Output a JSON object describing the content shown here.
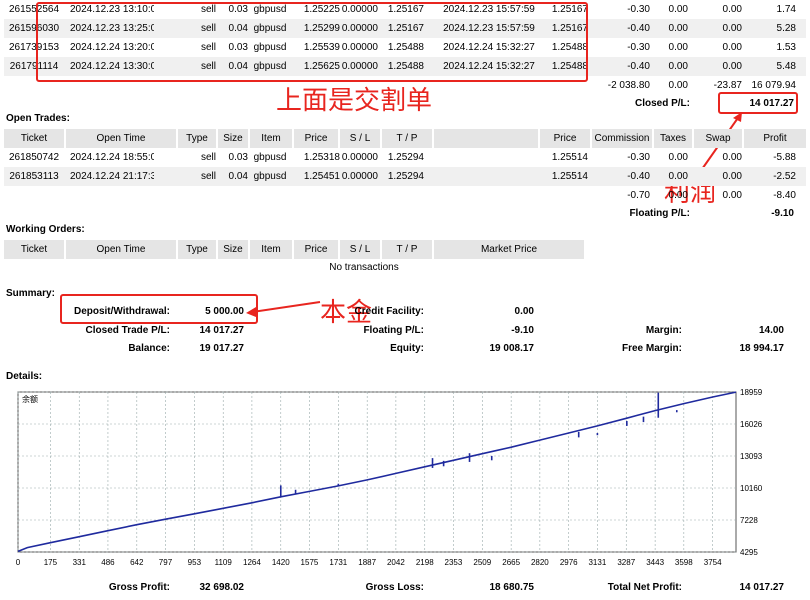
{
  "closed_rows": [
    [
      "261552564",
      "2024.12.23 13:10:02",
      "sell",
      "0.03",
      "gbpusd",
      "1.25225",
      "0.00000",
      "1.25167",
      "2024.12.23 15:57:59",
      "1.25167",
      "-0.30",
      "0.00",
      "0.00",
      "1.74"
    ],
    [
      "261596030",
      "2024.12.23 13:25:03",
      "sell",
      "0.04",
      "gbpusd",
      "1.25299",
      "0.00000",
      "1.25167",
      "2024.12.23 15:57:59",
      "1.25167",
      "-0.40",
      "0.00",
      "0.00",
      "5.28"
    ],
    [
      "261739153",
      "2024.12.24 13:20:00",
      "sell",
      "0.03",
      "gbpusd",
      "1.25539",
      "0.00000",
      "1.25488",
      "2024.12.24 15:32:27",
      "1.25488",
      "-0.30",
      "0.00",
      "0.00",
      "1.53"
    ],
    [
      "261791114",
      "2024.12.24 13:30:01",
      "sell",
      "0.04",
      "gbpusd",
      "1.25625",
      "0.00000",
      "1.25488",
      "2024.12.24 15:32:27",
      "1.25488",
      "-0.40",
      "0.00",
      "0.00",
      "5.48"
    ]
  ],
  "closed_totals": {
    "commission": "-2 038.80",
    "taxes": "0.00",
    "swap": "-23.87",
    "profit": "16 079.94"
  },
  "closed_pl": {
    "label": "Closed P/L:",
    "value": "14 017.27"
  },
  "annotations": {
    "closed_box": "上面是交割单",
    "profit": "利润",
    "capital": "本金"
  },
  "open_trades": {
    "title": "Open Trades:",
    "headers": [
      "Ticket",
      "Open Time",
      "Type",
      "Size",
      "Item",
      "Price",
      "S / L",
      "T / P",
      "",
      "Price",
      "Commission",
      "Taxes",
      "Swap",
      "Profit"
    ],
    "rows": [
      [
        "261850742",
        "2024.12.24 18:55:03",
        "sell",
        "0.03",
        "gbpusd",
        "1.25318",
        "0.00000",
        "1.25294",
        "",
        "1.25514",
        "-0.30",
        "0.00",
        "0.00",
        "-5.88"
      ],
      [
        "261853113",
        "2024.12.24 21:17:31",
        "sell",
        "0.04",
        "gbpusd",
        "1.25451",
        "0.00000",
        "1.25294",
        "",
        "1.25514",
        "-0.40",
        "0.00",
        "0.00",
        "-2.52"
      ]
    ],
    "totals": {
      "commission": "-0.70",
      "taxes": "0.00",
      "swap": "0.00",
      "profit": "-8.40"
    },
    "floating": {
      "label": "Floating P/L:",
      "value": "-9.10"
    }
  },
  "working_orders": {
    "title": "Working Orders:",
    "headers": [
      "Ticket",
      "Open Time",
      "Type",
      "Size",
      "Item",
      "Price",
      "S / L",
      "T / P",
      "Market Price"
    ],
    "empty": "No transactions"
  },
  "summary": {
    "title": "Summary:",
    "deposit": {
      "label": "Deposit/Withdrawal:",
      "value": "5 000.00"
    },
    "credit": {
      "label": "Credit Facility:",
      "value": "0.00"
    },
    "closed_trade": {
      "label": "Closed Trade P/L:",
      "value": "14 017.27"
    },
    "floating": {
      "label": "Floating P/L:",
      "value": "-9.10"
    },
    "margin": {
      "label": "Margin:",
      "value": "14.00"
    },
    "balance": {
      "label": "Balance:",
      "value": "19 017.27"
    },
    "equity": {
      "label": "Equity:",
      "value": "19 008.17"
    },
    "free_margin": {
      "label": "Free Margin:",
      "value": "18 994.17"
    }
  },
  "details_title": "Details:",
  "chart_data": {
    "type": "line",
    "title": "余额",
    "xlabel": "",
    "ylabel": "",
    "x_ticks": [
      0,
      175,
      331,
      486,
      642,
      797,
      953,
      1109,
      1264,
      1420,
      1575,
      1731,
      1887,
      2042,
      2198,
      2353,
      2509,
      2665,
      2820,
      2976,
      3131,
      3287,
      3443,
      3598,
      3754
    ],
    "y_ticks": [
      4295,
      7228,
      10160,
      13093,
      16026,
      18959
    ],
    "xlim": [
      0,
      3880
    ],
    "ylim": [
      4295,
      18959
    ],
    "grid": true,
    "series": [
      {
        "name": "",
        "color": "#1f2a9e",
        "x": [
          0,
          50,
          175,
          331,
          486,
          642,
          797,
          953,
          1109,
          1264,
          1420,
          1575,
          1731,
          1887,
          2042,
          2198,
          2353,
          2509,
          2665,
          2820,
          2976,
          3131,
          3287,
          3443,
          3598,
          3754,
          3880
        ],
        "y": [
          4350,
          4700,
          5150,
          5700,
          6250,
          6800,
          7300,
          7800,
          8300,
          8800,
          9350,
          9850,
          10350,
          10900,
          11500,
          12100,
          12700,
          13300,
          13900,
          14550,
          15200,
          15850,
          16550,
          17250,
          17900,
          18500,
          18950
        ]
      }
    ],
    "spikes": [
      [
        1420,
        9300,
        10400
      ],
      [
        1500,
        9600,
        10000
      ],
      [
        1731,
        10300,
        10550
      ],
      [
        2240,
        12000,
        12900
      ],
      [
        2300,
        12150,
        12650
      ],
      [
        2440,
        12550,
        13350
      ],
      [
        2560,
        12700,
        13100
      ],
      [
        3030,
        14800,
        15300
      ],
      [
        3131,
        15000,
        15200
      ],
      [
        3290,
        15850,
        16300
      ],
      [
        3380,
        16200,
        16700
      ],
      [
        3460,
        16600,
        18900
      ],
      [
        3560,
        17100,
        17300
      ]
    ]
  },
  "footer": {
    "gross_profit": {
      "label": "Gross Profit:",
      "value": "32 698.02"
    },
    "gross_loss": {
      "label": "Gross Loss:",
      "value": "18 680.75"
    },
    "total_net": {
      "label": "Total Net Profit:",
      "value": "14 017.27"
    }
  }
}
